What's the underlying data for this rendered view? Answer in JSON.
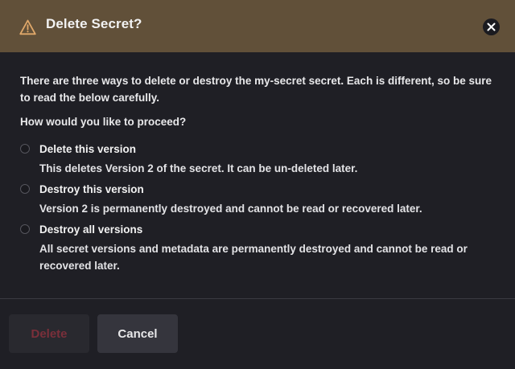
{
  "dialog": {
    "title": "Delete Secret?",
    "description": "There are three ways to delete or destroy the my-secret secret. Each is different, so be sure to read the below carefully.",
    "question": "How would you like to proceed?",
    "options": [
      {
        "label": "Delete this version",
        "description": "This deletes Version 2 of the secret. It can be un-deleted later.",
        "selected": false
      },
      {
        "label": "Destroy this version",
        "description": "Version 2 is permanently destroyed and cannot be read or recovered later.",
        "selected": false
      },
      {
        "label": "Destroy all versions",
        "description": "All secret versions and metadata are permanently destroyed and cannot be read or recovered later.",
        "selected": false
      }
    ],
    "buttons": {
      "delete_label": "Delete",
      "cancel_label": "Cancel"
    }
  },
  "icons": {
    "header": "warning-triangle-icon",
    "close": "close-icon"
  },
  "colors": {
    "header_bg": "#615039",
    "body_bg": "#1f1f25",
    "warning_accent": "#e0a86a",
    "delete_text_disabled": "#7a2f3a",
    "cancel_bg": "#35353d"
  }
}
